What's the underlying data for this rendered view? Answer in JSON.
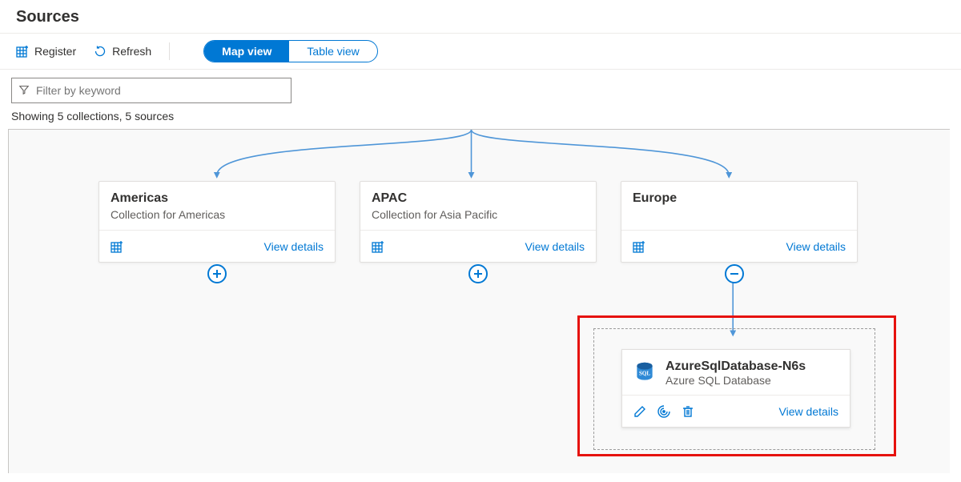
{
  "header": {
    "title": "Sources"
  },
  "toolbar": {
    "register": "Register",
    "refresh": "Refresh",
    "map_view": "Map view",
    "table_view": "Table view"
  },
  "filter": {
    "placeholder": "Filter by keyword"
  },
  "count_text": "Showing 5 collections, 5 sources",
  "view_details": "View details",
  "cards": {
    "americas": {
      "title": "Americas",
      "subtitle": "Collection for Americas"
    },
    "apac": {
      "title": "APAC",
      "subtitle": "Collection for Asia Pacific"
    },
    "europe": {
      "title": "Europe",
      "subtitle": ""
    }
  },
  "source": {
    "title": "AzureSqlDatabase-N6s",
    "subtitle": "Azure SQL Database"
  },
  "icons": {
    "register": "grid-register-icon",
    "refresh": "refresh-icon",
    "filter": "filter-icon"
  }
}
